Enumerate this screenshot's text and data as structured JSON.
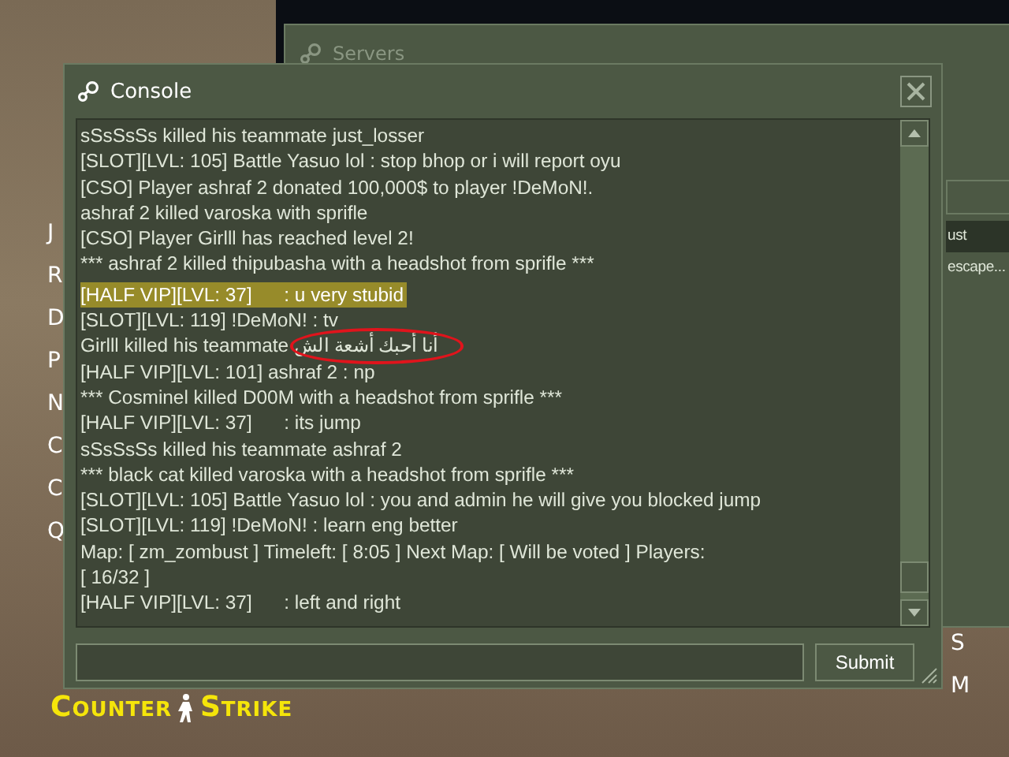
{
  "background_menu": {
    "left_letters": [
      "J",
      "R",
      "D",
      "P",
      "N",
      "C",
      "C",
      "Q"
    ],
    "right_letters": [
      "S",
      "M"
    ]
  },
  "servers_window": {
    "title": "Servers",
    "rows": [
      {
        "text": "ust",
        "selected": true
      },
      {
        "text": "escape...",
        "selected": false
      }
    ]
  },
  "console": {
    "title": "Console",
    "lines": [
      {
        "text": "sSsSsSs killed his teammate just_losser",
        "highlighted": false
      },
      {
        "text": "[SLOT][LVL: 105] Battle Yasuo lol : stop bhop or i will report oyu",
        "highlighted": false
      },
      {
        "text": "[CSO] Player ashraf 2 donated 100,000$ to player !DeMoN!.",
        "highlighted": false
      },
      {
        "text": "ashraf 2 killed varoska with sprifle",
        "highlighted": false
      },
      {
        "text": "[CSO] Player Girlll has reached level 2!",
        "highlighted": false
      },
      {
        "text": "*** ashraf 2 killed thipubasha with a headshot from sprifle ***",
        "highlighted": false
      },
      {
        "text": "[HALF VIP][LVL: 37]      : u very stubid",
        "highlighted": true
      },
      {
        "text": "[SLOT][LVL: 119] !DeMoN! : tv",
        "highlighted": false
      },
      {
        "text": "Girlll killed his teammate",
        "rtl_text": "أنا أحبك أشعة الش",
        "highlighted": false,
        "circled": true
      },
      {
        "text": "[HALF VIP][LVL: 101] ashraf 2 : np",
        "highlighted": false
      },
      {
        "text": "*** Cosminel killed D00M with a headshot from sprifle ***",
        "highlighted": false
      },
      {
        "text": "[HALF VIP][LVL: 37]      : its jump",
        "highlighted": false
      },
      {
        "text": "sSsSsSs killed his teammate ashraf 2",
        "highlighted": false
      },
      {
        "text": "*** black cat killed varoska with a headshot from sprifle ***",
        "highlighted": false
      },
      {
        "text": "[SLOT][LVL: 105] Battle Yasuo lol : you and admin he will give you blocked jump",
        "highlighted": false
      },
      {
        "text": "[SLOT][LVL: 119] !DeMoN! : learn eng better",
        "highlighted": false
      },
      {
        "text": "Map: [ zm_zombust ] Timeleft: [ 8:05 ] Next Map: [ Will be voted ] Players:",
        "highlighted": false
      },
      {
        "text": "[ 16/32 ]",
        "highlighted": false
      },
      {
        "text": "[HALF VIP][LVL: 37]      : left and right",
        "highlighted": false
      }
    ],
    "submit_button": "Submit"
  },
  "logo": {
    "left": "Counter",
    "right": "Strike"
  }
}
